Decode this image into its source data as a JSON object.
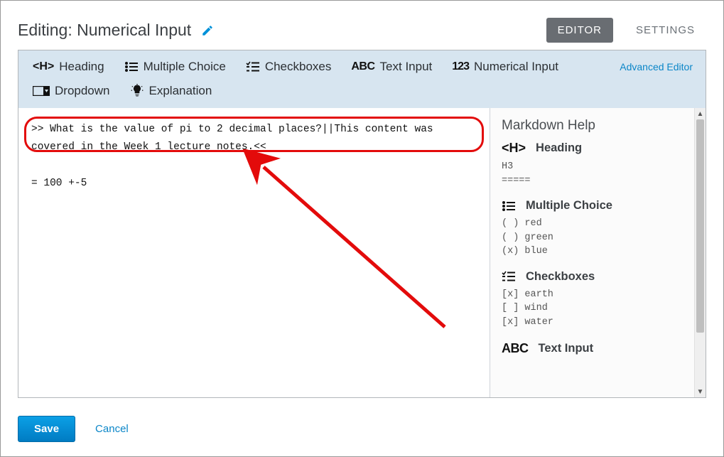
{
  "header": {
    "title": "Editing: Numerical Input",
    "tabs": {
      "editor": "EDITOR",
      "settings": "SETTINGS"
    }
  },
  "toolbar": {
    "heading": "Heading",
    "multipleChoice": "Multiple Choice",
    "checkboxes": "Checkboxes",
    "textInput": "Text Input",
    "numericalInput": "Numerical Input",
    "dropdown": "Dropdown",
    "explanation": "Explanation",
    "advanced": "Advanced Editor"
  },
  "editorContent": ">> What is the value of pi to 2 decimal places?||This content was covered in the Week 1 lecture notes.<<\n\n= 100 +-5",
  "help": {
    "title": "Markdown Help",
    "heading": {
      "label": "Heading",
      "example": "H3\n====="
    },
    "multipleChoice": {
      "label": "Multiple Choice",
      "example": "( ) red\n( ) green\n(x) blue"
    },
    "checkboxes": {
      "label": "Checkboxes",
      "example": "[x] earth\n[ ] wind\n[x] water"
    },
    "textInput": {
      "label": "Text Input"
    }
  },
  "footer": {
    "save": "Save",
    "cancel": "Cancel"
  },
  "colors": {
    "accent": "#008ad1",
    "link": "#0b86c8",
    "annotation": "#e30b0b"
  }
}
